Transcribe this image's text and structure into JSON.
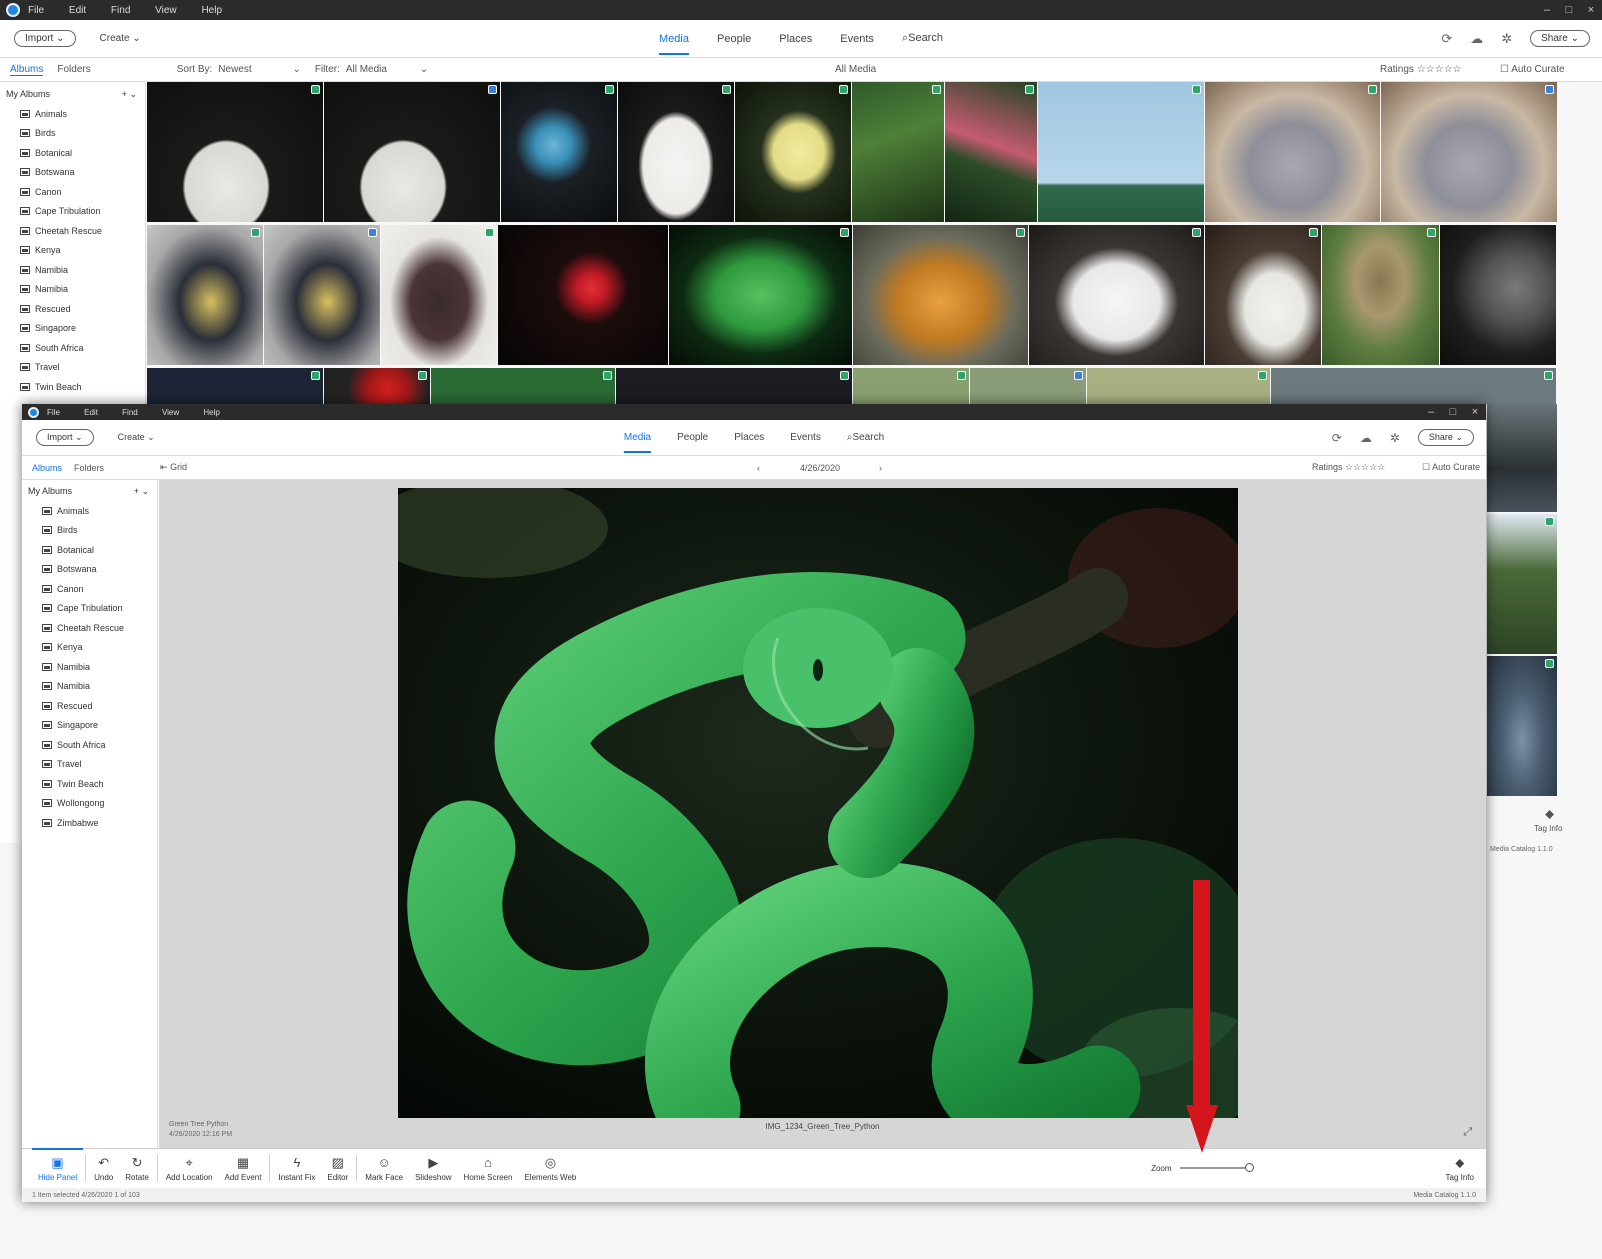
{
  "back_window": {
    "menu": [
      "File",
      "Edit",
      "Find",
      "View",
      "Help"
    ],
    "toolbar": {
      "import_label": "Import",
      "create_label": "Create",
      "tabs": [
        "Media",
        "People",
        "Places",
        "Events"
      ],
      "active_tab": "Media",
      "search_label": "Search",
      "share_label": "Share"
    },
    "subbar": {
      "albums_tab": "Albums",
      "folders_tab": "Folders",
      "sort_label": "Sort By:",
      "sort_value": "Newest",
      "filter_label": "Filter:",
      "filter_value": "All Media",
      "view_label": "All Media",
      "ratings_label": "Ratings",
      "ratings_stars": "☆☆☆☆☆",
      "autocurate_label": "Auto Curate"
    },
    "sidebar": {
      "heading": "My Albums",
      "albums": [
        "Animals",
        "Birds",
        "Botanical",
        "Botswana",
        "Canon",
        "Cape Tribulation",
        "Cheetah Rescue",
        "Kenya",
        "Namibia",
        "Namibia",
        "Rescued",
        "Singapore",
        "South Africa",
        "Travel",
        "Twin Beach"
      ]
    },
    "status_right": "Media Catalog 1.1.0"
  },
  "front_window": {
    "menu": [
      "File",
      "Edit",
      "Find",
      "View",
      "Help"
    ],
    "toolbar": {
      "import_label": "Import",
      "create_label": "Create",
      "tabs": [
        "Media",
        "People",
        "Places",
        "Events"
      ],
      "active_tab": "Media",
      "search_label": "Search",
      "share_label": "Share"
    },
    "subbar": {
      "albums_tab": "Albums",
      "folders_tab": "Folders",
      "back_label": "Grid",
      "date_label": "4/26/2020",
      "ratings_label": "Ratings",
      "ratings_stars": "☆☆☆☆☆",
      "autocurate_label": "Auto Curate"
    },
    "sidebar": {
      "heading": "My Albums",
      "albums": [
        "Animals",
        "Birds",
        "Botanical",
        "Botswana",
        "Canon",
        "Cape Tribulation",
        "Cheetah Rescue",
        "Kenya",
        "Namibia",
        "Namibia",
        "Rescued",
        "Singapore",
        "South Africa",
        "Travel",
        "Twin Beach",
        "Wollongong",
        "Zimbabwe"
      ]
    },
    "viewer": {
      "caption": "IMG_1234_Green_Tree_Python",
      "left_info_line1": "Green Tree Python",
      "left_info_line2": "4/26/2020 12:16 PM"
    },
    "bottom_tools": [
      {
        "label": "Hide Panel",
        "icon": "panel-icon",
        "glyph": "▣",
        "active": true
      },
      {
        "label": "Undo",
        "icon": "undo-icon",
        "glyph": "↶",
        "active": false
      },
      {
        "label": "Rotate",
        "icon": "rotate-icon",
        "glyph": "↻",
        "active": false
      },
      {
        "label": "Add Location",
        "icon": "location-icon",
        "glyph": "⌖",
        "active": false
      },
      {
        "label": "Add Event",
        "icon": "calendar-icon",
        "glyph": "▦",
        "active": false
      },
      {
        "label": "Instant Fix",
        "icon": "lightning-icon",
        "glyph": "ϟ",
        "active": false
      },
      {
        "label": "Editor",
        "icon": "editor-icon",
        "glyph": "▨",
        "active": false
      },
      {
        "label": "Mark Face",
        "icon": "face-icon",
        "glyph": "☺",
        "active": false
      },
      {
        "label": "Slideshow",
        "icon": "slideshow-icon",
        "glyph": "▶",
        "active": false
      },
      {
        "label": "Home Screen",
        "icon": "home-icon",
        "glyph": "⌂",
        "active": false
      },
      {
        "label": "Elements Web",
        "icon": "globe-icon",
        "glyph": "◎",
        "active": false
      }
    ],
    "zoom_label": "Zoom",
    "zoom_level": 1.0,
    "tag_info_label": "Tag Info",
    "status_left": "1 Item selected  4/26/2020  1 of 103",
    "status_right": "Media Catalog 1.1.0"
  },
  "annotation": {
    "arrow_color": "#d4151b",
    "arrow_direction": "down"
  },
  "colors": {
    "accent": "#1473e6",
    "badge_green": "#2ea36a",
    "badge_blue": "#3d7fd6"
  }
}
